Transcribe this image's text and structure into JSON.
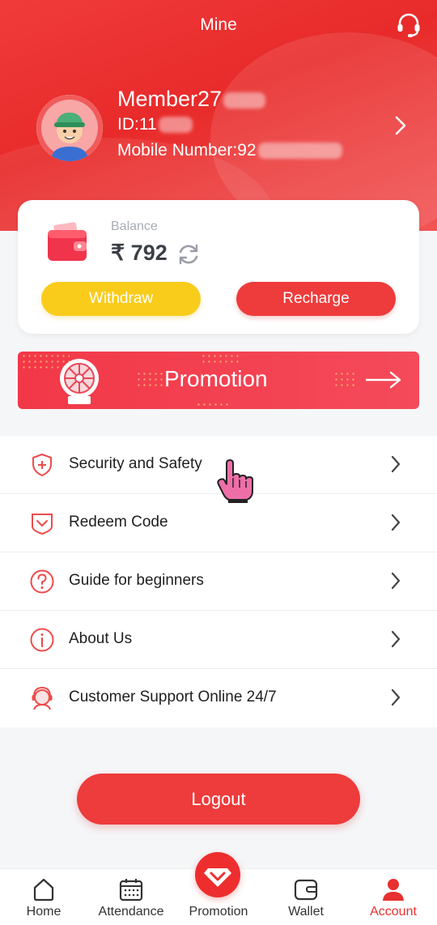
{
  "header": {
    "title": "Mine",
    "support_icon": "headset-icon"
  },
  "profile": {
    "name": "Member27",
    "id_label": "ID:11",
    "mobile_label": "Mobile Number:92",
    "avatar_icon": "boy-avatar-icon",
    "chevron_icon": "chevron-right-icon"
  },
  "balance": {
    "label": "Balance",
    "amount": "₹ 792",
    "wallet_icon": "wallet-icon",
    "refresh_icon": "refresh-icon",
    "withdraw_label": "Withdraw",
    "recharge_label": "Recharge"
  },
  "promotion_banner": {
    "label": "Promotion",
    "icon": "prize-wheel-icon",
    "arrow_icon": "arrow-right-icon"
  },
  "menu": {
    "items": [
      {
        "label": "Security and Safety",
        "icon": "shield-plus-icon"
      },
      {
        "label": "Redeem Code",
        "icon": "redeem-badge-icon"
      },
      {
        "label": "Guide for beginners",
        "icon": "question-circle-icon"
      },
      {
        "label": "About Us",
        "icon": "info-circle-icon"
      },
      {
        "label": "Customer Support Online 24/7",
        "icon": "support-agent-icon"
      }
    ]
  },
  "logout_label": "Logout",
  "bottom_nav": {
    "items": [
      {
        "label": "Home",
        "icon": "home-icon"
      },
      {
        "label": "Attendance",
        "icon": "calendar-icon"
      },
      {
        "label": "Promotion",
        "icon": "diamond-icon"
      },
      {
        "label": "Wallet",
        "icon": "wallet-outline-icon"
      },
      {
        "label": "Account",
        "icon": "person-icon"
      }
    ],
    "active": "Account"
  },
  "colors": {
    "primary_red": "#ee3b3b",
    "withdraw_yellow": "#f9cc1c",
    "background": "#f5f6f8"
  }
}
